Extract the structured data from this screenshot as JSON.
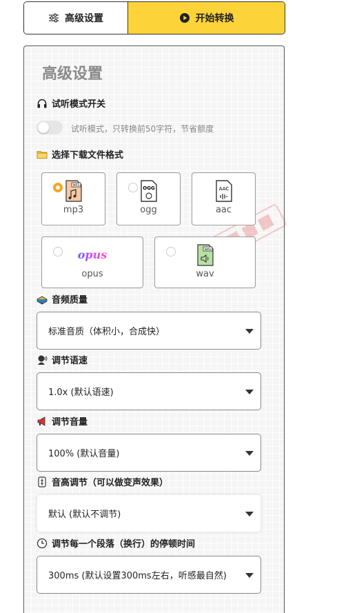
{
  "tabs": {
    "advanced": "高级设置",
    "convert": "开始转换"
  },
  "panel": {
    "title": "高级设置",
    "preview": {
      "label": "试听模式开关",
      "description": "试听模式，只转换前50字符，节省额度",
      "enabled": false
    },
    "format": {
      "label": "选择下载文件格式",
      "selected": "mp3",
      "options": [
        {
          "name": "mp3",
          "icon_text": "MP3"
        },
        {
          "name": "ogg",
          "icon_text": "OGG"
        },
        {
          "name": "aac",
          "icon_text": "AAC"
        },
        {
          "name": "opus",
          "icon_text": "opus"
        },
        {
          "name": "wav",
          "icon_text": "WAV"
        }
      ]
    },
    "quality": {
      "label": "音频质量",
      "value": "标准音质（体积小，合成快）"
    },
    "speed": {
      "label": "调节语速",
      "value": "1.0x (默认语速)"
    },
    "volume": {
      "label": "调节音量",
      "value": "100% (默认音量)"
    },
    "pitch": {
      "label": "音高调节（可以做变声效果）",
      "value": "默认 (默认不调节)"
    },
    "pause": {
      "label": "调节每一个段落（换行）的停顿时间",
      "value": "300ms (默认设置300ms左右，听感最自然)"
    }
  },
  "colors": {
    "accent_yellow": "#fdd33a",
    "radio_orange": "#f5a623",
    "panel_bg": "#f5f5f5"
  }
}
